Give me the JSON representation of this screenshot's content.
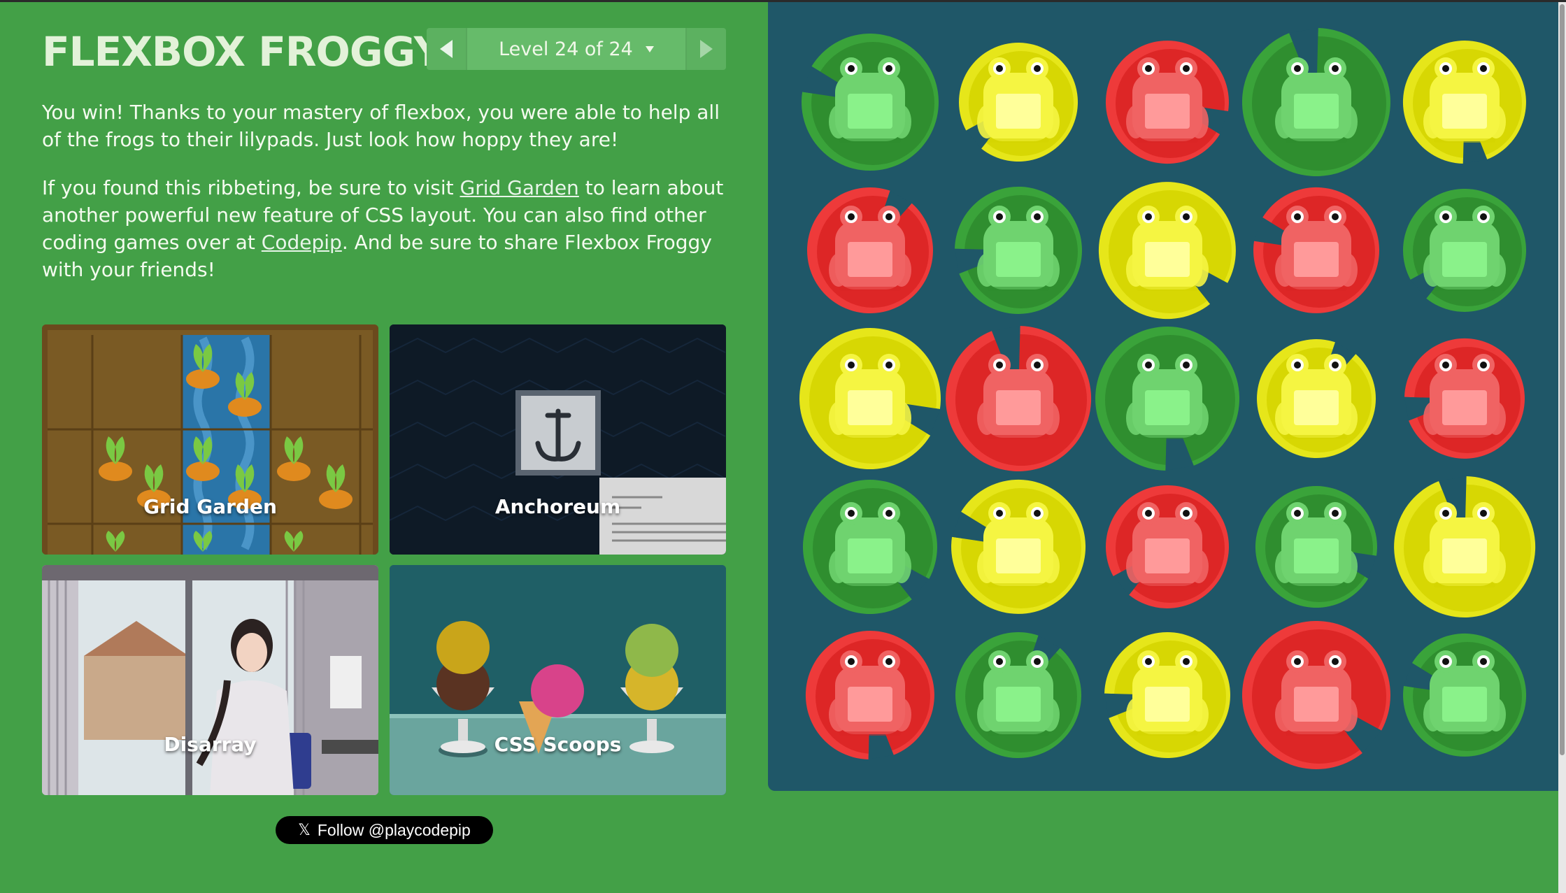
{
  "header": {
    "title": "FLEXBOX FROGGY",
    "level_text": "Level 24 of 24"
  },
  "intro": {
    "p1": "You win! Thanks to your mastery of flexbox, you were able to help all of the frogs to their lilypads. Just look how hoppy they are!",
    "p2_a": "If you found this ribbeting, be sure to visit ",
    "p2_link1": "Grid Garden",
    "p2_b": " to learn about another powerful new feature of CSS layout. You can also find other coding games over at ",
    "p2_link2": "Codepip",
    "p2_c": ". And be sure to share Flexbox Froggy with your friends!"
  },
  "games": [
    {
      "label": "Grid Garden"
    },
    {
      "label": "Anchoreum"
    },
    {
      "label": "Disarray"
    },
    {
      "label": "CSS Scoops"
    }
  ],
  "follow": {
    "label": "Follow @playcodepip",
    "icon": "x-logo-icon"
  },
  "colors": {
    "background": "#43a047",
    "pond": "#1f5768",
    "green_pad": "#2e8b2e",
    "green_frog": "#6fd36f",
    "yellow_pad": "#d4d400",
    "yellow_frog": "#f5f542",
    "red_pad": "#d92323",
    "red_frog": "#f06363"
  },
  "frog_grid": [
    [
      "green",
      "yellow",
      "red",
      "green",
      "yellow"
    ],
    [
      "red",
      "green",
      "yellow",
      "red",
      "green"
    ],
    [
      "yellow",
      "red",
      "green",
      "yellow",
      "red"
    ],
    [
      "green",
      "yellow",
      "red",
      "green",
      "yellow"
    ],
    [
      "red",
      "green",
      "yellow",
      "red",
      "green"
    ]
  ]
}
